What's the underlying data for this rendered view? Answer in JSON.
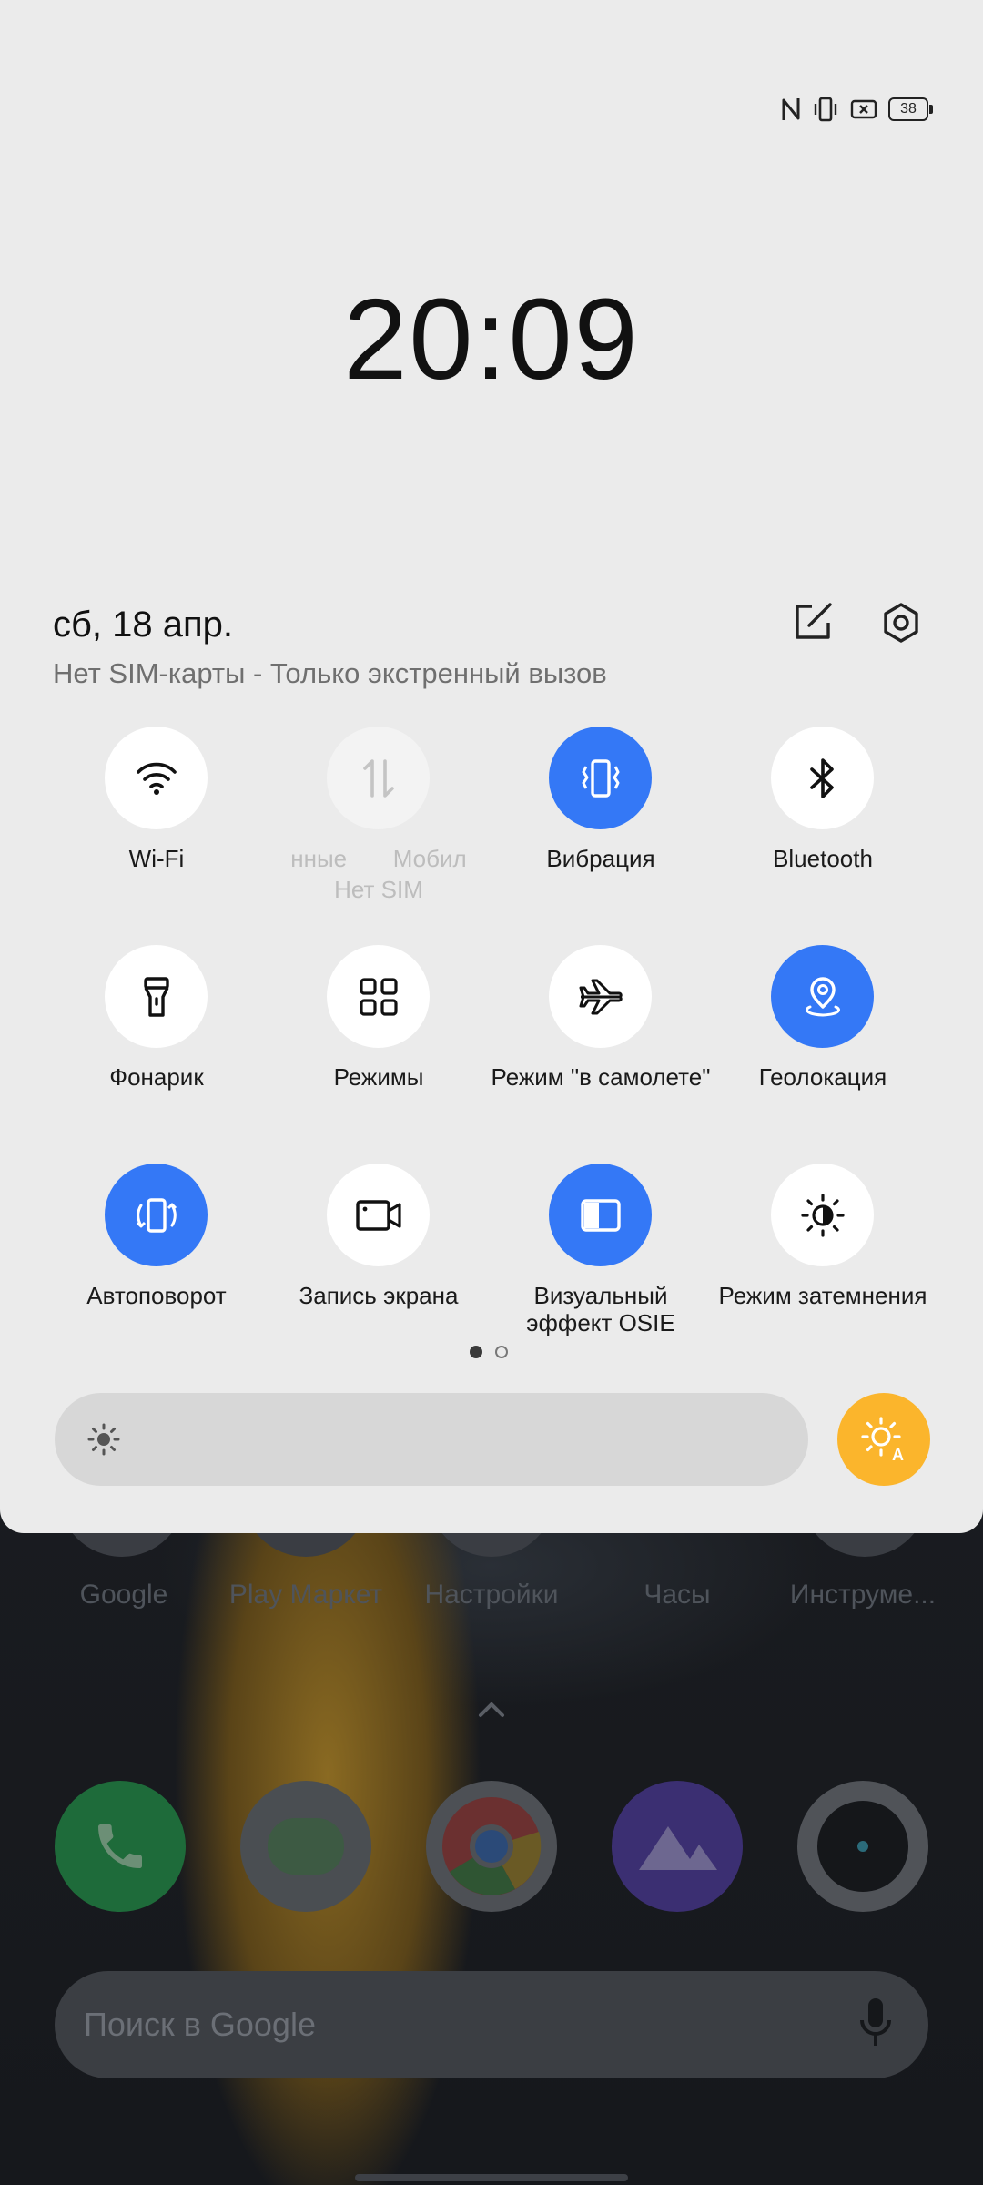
{
  "status_bar": {
    "battery": "38",
    "icons": [
      "nfc-icon",
      "vibrate-icon",
      "no-sim-icon",
      "battery-icon"
    ]
  },
  "lockscreen": {
    "clock": "20:09"
  },
  "header": {
    "date": "сб, 18 апр.",
    "sim_status": "Нет SIM-карты - Только экстренный вызов"
  },
  "tiles": [
    {
      "label": "Wi-Fi",
      "icon": "wifi-icon",
      "state": "off"
    },
    {
      "label": "нные       Мобил",
      "sublabel": "Нет SIM",
      "icon": "mobile-data-icon",
      "state": "disabled"
    },
    {
      "label": "Вибрация",
      "icon": "vibrate-icon",
      "state": "on"
    },
    {
      "label": "Bluetooth",
      "icon": "bluetooth-icon",
      "state": "off"
    },
    {
      "label": "Фонарик",
      "icon": "flashlight-icon",
      "state": "off"
    },
    {
      "label": "Режимы",
      "icon": "modes-grid-icon",
      "state": "off"
    },
    {
      "label": "Режим \"в самолете\"",
      "icon": "airplane-icon",
      "state": "off"
    },
    {
      "label": "Геолокация",
      "icon": "location-icon",
      "state": "on"
    },
    {
      "label": "Автоповорот",
      "icon": "auto-rotate-icon",
      "state": "on"
    },
    {
      "label": "Запись экрана",
      "icon": "screen-record-icon",
      "state": "off"
    },
    {
      "label": "Визуальный эффект OSIE",
      "icon": "osie-icon",
      "state": "on"
    },
    {
      "label": "Режим затемнения",
      "icon": "dark-mode-icon",
      "state": "off"
    }
  ],
  "pagination": {
    "current": 1,
    "total": 2
  },
  "brightness": {
    "level": 0.0
  },
  "home_apps": [
    "Google",
    "Play Маркет",
    "Настройки",
    "Часы",
    "Инструме..."
  ],
  "dock": [
    "phone-icon",
    "messages-icon",
    "chrome-icon",
    "gallery-icon",
    "camera-icon"
  ],
  "search": {
    "placeholder": "Поиск в Google"
  },
  "colors": {
    "accent": "#3478f6",
    "auto_brightness": "#fbb52c",
    "shade_bg": "#ebebeb"
  }
}
